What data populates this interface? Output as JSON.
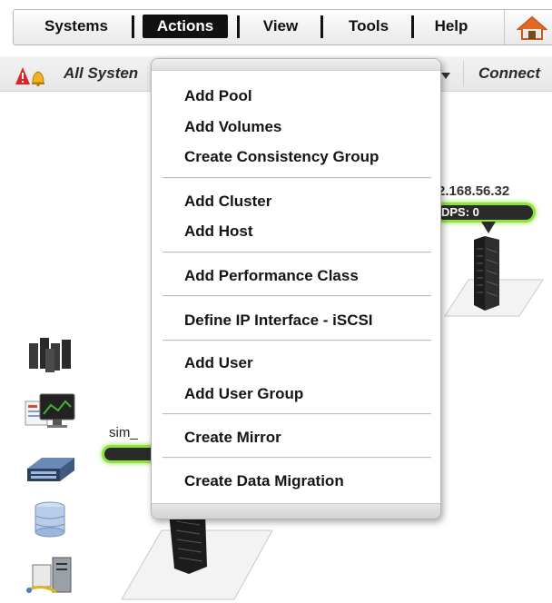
{
  "menubar": {
    "items": [
      {
        "label": "Systems"
      },
      {
        "label": "Actions"
      },
      {
        "label": "View"
      },
      {
        "label": "Tools"
      },
      {
        "label": "Help"
      }
    ],
    "active": "Actions"
  },
  "statusbar": {
    "systems_label": "All Systen",
    "connect_label": "Connect"
  },
  "workspace": {
    "right_node": {
      "ip": "2.168.56.32",
      "iops": "DPS: 0"
    },
    "left_node": {
      "label": "sim_"
    }
  },
  "actions_menu": {
    "groups": [
      [
        "Add Pool",
        "Add Volumes",
        "Create Consistency Group"
      ],
      [
        "Add Cluster",
        "Add Host"
      ],
      [
        "Add Performance Class"
      ],
      [
        "Define IP Interface - iSCSI"
      ],
      [
        "Add User",
        "Add User Group"
      ],
      [
        "Create Mirror"
      ],
      [
        "Create Data Migration"
      ]
    ]
  },
  "icons": {
    "home": "home-icon",
    "alert": "alert-bells-icon",
    "side": [
      "servers-icon",
      "dashboard-monitor-icon",
      "storage-array-icon",
      "database-icon",
      "host-computer-icon"
    ]
  },
  "colors": {
    "accent_green": "#8ce33b",
    "menu_active_bg": "#111111"
  }
}
